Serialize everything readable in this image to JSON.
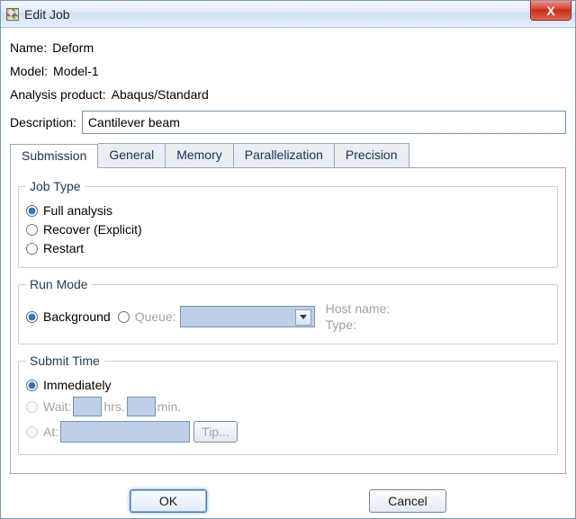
{
  "window": {
    "title": "Edit Job",
    "close_glyph": "X"
  },
  "fields": {
    "name_label": "Name:",
    "name_value": "Deform",
    "model_label": "Model:",
    "model_value": "Model-1",
    "product_label": "Analysis product:",
    "product_value": "Abaqus/Standard",
    "description_label": "Description:",
    "description_value": "Cantilever beam"
  },
  "tabs": {
    "submission": "Submission",
    "general": "General",
    "memory": "Memory",
    "parallel": "Parallelization",
    "precision": "Precision"
  },
  "jobtype": {
    "legend": "Job Type",
    "full": "Full analysis",
    "recover": "Recover (Explicit)",
    "restart": "Restart"
  },
  "runmode": {
    "legend": "Run Mode",
    "background": "Background",
    "queue": "Queue:",
    "host_label": "Host name:",
    "type_label": "Type:"
  },
  "submittime": {
    "legend": "Submit Time",
    "immediately": "Immediately",
    "wait": "Wait:",
    "hrs": "hrs.",
    "min": "min.",
    "at": "At:",
    "tip": "Tip..."
  },
  "buttons": {
    "ok": "OK",
    "cancel": "Cancel"
  }
}
